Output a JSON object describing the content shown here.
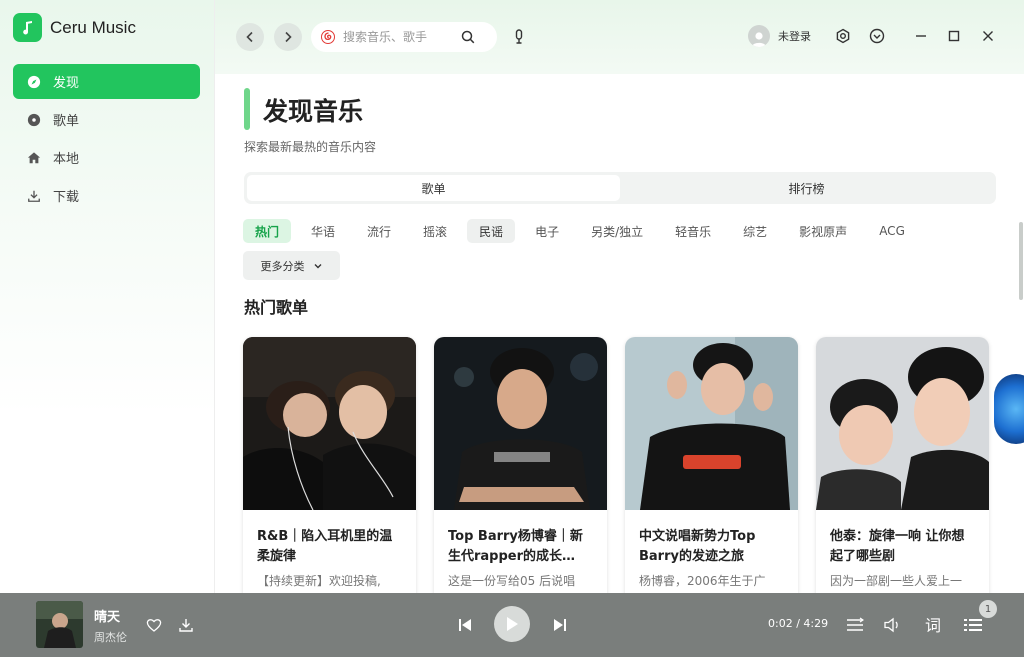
{
  "app": {
    "name": "Ceru Music"
  },
  "sidebar": {
    "items": [
      {
        "label": "发现",
        "icon": "compass-icon",
        "active": true
      },
      {
        "label": "歌单",
        "icon": "disc-icon",
        "active": false
      },
      {
        "label": "本地",
        "icon": "home-icon",
        "active": false
      },
      {
        "label": "下载",
        "icon": "download-icon",
        "active": false
      }
    ]
  },
  "topbar": {
    "search_placeholder": "搜索音乐、歌手",
    "user_label": "未登录"
  },
  "main": {
    "title": "发现音乐",
    "subtitle": "探索最新最热的音乐内容",
    "segments": [
      {
        "label": "歌单",
        "active": true
      },
      {
        "label": "排行榜",
        "active": false
      }
    ],
    "tags": [
      {
        "label": "热门",
        "state": "active"
      },
      {
        "label": "华语",
        "state": ""
      },
      {
        "label": "流行",
        "state": ""
      },
      {
        "label": "摇滚",
        "state": ""
      },
      {
        "label": "民谣",
        "state": "hover"
      },
      {
        "label": "电子",
        "state": ""
      },
      {
        "label": "另类/独立",
        "state": ""
      },
      {
        "label": "轻音乐",
        "state": ""
      },
      {
        "label": "综艺",
        "state": ""
      },
      {
        "label": "影视原声",
        "state": ""
      },
      {
        "label": "ACG",
        "state": ""
      }
    ],
    "more_categories": "更多分类",
    "section_title": "热门歌单",
    "playlists": [
      {
        "title": "R&B｜陷入耳机里的温柔旋律",
        "desc": "【持续更新】欢迎投稿,"
      },
      {
        "title": "Top Barry杨博睿｜新生代rapper的成长…",
        "desc": "这是一份写给05 后说唱"
      },
      {
        "title": "中文说唱新势力Top Barry的发迹之旅",
        "desc": "杨博睿，2006年生于广"
      },
      {
        "title": "他泰：旋律一响 让你想起了哪些剧",
        "desc": "因为一部剧一些人爱上一"
      }
    ]
  },
  "player": {
    "song": "晴天",
    "artist": "周杰伦",
    "time_current": "0:02",
    "time_total": "4:29",
    "time_display": "0:02 / 4:29",
    "lyrics_label": "词",
    "queue_count": "1",
    "accent": "#22c55e"
  }
}
